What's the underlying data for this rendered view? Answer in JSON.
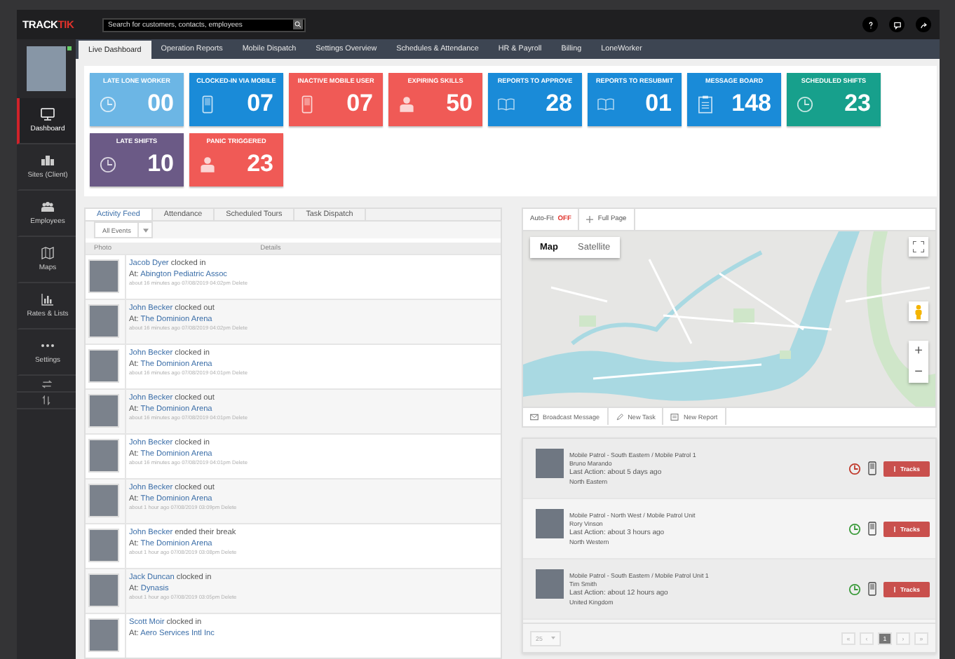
{
  "topbar": {
    "logo": {
      "part_1": "TRACK",
      "part_2": "TIK"
    },
    "search": {
      "placeholder": "Search for customers, contacts, employees"
    }
  },
  "sidebar": {
    "items": [
      {
        "label": "Dashboard",
        "kind": "monitor",
        "selected": true
      },
      {
        "label": "Sites (Client)",
        "kind": "building",
        "selected": false
      },
      {
        "label": "Employees",
        "kind": "people",
        "selected": false
      },
      {
        "label": "Maps",
        "kind": "map",
        "selected": false
      },
      {
        "label": "Rates & Lists",
        "kind": "chart",
        "selected": false
      },
      {
        "label": "Settings",
        "kind": "dots",
        "selected": false
      }
    ]
  },
  "tabs": [
    {
      "label": "Live Dashboard",
      "selected": true
    },
    {
      "label": "Operation Reports",
      "selected": false
    },
    {
      "label": "Mobile Dispatch",
      "selected": false
    },
    {
      "label": "Settings Overview",
      "selected": false
    },
    {
      "label": "Schedules & Attendance",
      "selected": false
    },
    {
      "label": "HR & Payroll",
      "selected": false
    },
    {
      "label": "Billing",
      "selected": false
    },
    {
      "label": "LoneWorker",
      "selected": false
    }
  ],
  "tiles": [
    {
      "label": "LATE LONE WORKER",
      "value": "00",
      "kind": "clock",
      "color": "#6cb6e5"
    },
    {
      "label": "CLOCKED-IN VIA MOBILE",
      "value": "07",
      "kind": "phone",
      "color": "#1a8bd8"
    },
    {
      "label": "INACTIVE MOBILE USER",
      "value": "07",
      "kind": "phone",
      "color": "#f05a56"
    },
    {
      "label": "EXPIRING SKILLS",
      "value": "50",
      "kind": "person",
      "color": "#f05a56"
    },
    {
      "label": "REPORTS TO APPROVE",
      "value": "28",
      "kind": "book",
      "color": "#1a8bd8"
    },
    {
      "label": "REPORTS TO RESUBMIT",
      "value": "01",
      "kind": "book",
      "color": "#1a8bd8"
    },
    {
      "label": "MESSAGE BOARD",
      "value": "148",
      "kind": "clipboard",
      "color": "#1a8bd8"
    },
    {
      "label": "SCHEDULED SHIFTS",
      "value": "23",
      "kind": "clock",
      "color": "#17a08c"
    },
    {
      "label": "LATE SHIFTS",
      "value": "10",
      "kind": "clock",
      "color": "#6b5a86"
    },
    {
      "label": "PANIC TRIGGERED",
      "value": "23",
      "kind": "person",
      "color": "#f05a56"
    }
  ],
  "activity": {
    "tabs": [
      {
        "label": "Activity Feed",
        "selected": true
      },
      {
        "label": "Attendance",
        "selected": false
      },
      {
        "label": "Scheduled Tours",
        "selected": false
      },
      {
        "label": "Task Dispatch",
        "selected": false
      }
    ],
    "filter": "All Events",
    "columns": [
      "Photo",
      "Details"
    ],
    "rows": [
      {
        "name": "Jacob Dyer",
        "action": "clocked in",
        "at_label": "At:",
        "place": "Abington Pediatric Assoc",
        "time": "about 16 minutes ago",
        "stamp": "07/08/2019 04:02pm",
        "delete": "Delete"
      },
      {
        "name": "John Becker",
        "action": "clocked out",
        "at_label": "At:",
        "place": "The Dominion Arena",
        "time": "about 16 minutes ago",
        "stamp": "07/08/2019 04:02pm",
        "delete": "Delete"
      },
      {
        "name": "John Becker",
        "action": "clocked in",
        "at_label": "At:",
        "place": "The Dominion Arena",
        "time": "about 16 minutes ago",
        "stamp": "07/08/2019 04:01pm",
        "delete": "Delete"
      },
      {
        "name": "John Becker",
        "action": "clocked out",
        "at_label": "At:",
        "place": "The Dominion Arena",
        "time": "about 16 minutes ago",
        "stamp": "07/08/2019 04:01pm",
        "delete": "Delete"
      },
      {
        "name": "John Becker",
        "action": "clocked in",
        "at_label": "At:",
        "place": "The Dominion Arena",
        "time": "about 16 minutes ago",
        "stamp": "07/08/2019 04:01pm",
        "delete": "Delete"
      },
      {
        "name": "John Becker",
        "action": "clocked out",
        "at_label": "At:",
        "place": "The Dominion Arena",
        "time": "about 1 hour ago",
        "stamp": "07/08/2019 03:09pm",
        "delete": "Delete"
      },
      {
        "name": "John Becker",
        "action": "ended their break",
        "at_label": "At:",
        "place": "The Dominion Arena",
        "time": "about 1 hour ago",
        "stamp": "07/08/2019 03:08pm",
        "delete": "Delete"
      },
      {
        "name": "Jack Duncan",
        "action": "clocked in",
        "at_label": "At:",
        "place": "Dynasis",
        "time": "about 1 hour ago",
        "stamp": "07/08/2019 03:05pm",
        "delete": "Delete"
      },
      {
        "name": "Scott Moir",
        "action": "clocked in",
        "at_label": "At:",
        "place": "Aero Services Intl Inc"
      }
    ]
  },
  "map": {
    "autofit": {
      "label": "Auto-Fit",
      "state": "OFF"
    },
    "full_page": "Full Page",
    "types": [
      {
        "label": "Map",
        "selected": true
      },
      {
        "label": "Satellite",
        "selected": false
      }
    ],
    "zoom_in": "+",
    "zoom_out": "−",
    "actions": [
      {
        "label": "Broadcast Message",
        "kind": "message"
      },
      {
        "label": "New Task",
        "kind": "task"
      },
      {
        "label": "New Report",
        "kind": "report"
      }
    ]
  },
  "patrols": {
    "rows": [
      {
        "unit": "Mobile Patrol - South Eastern / Mobile Patrol 1",
        "name": "Bruno Marando",
        "last_action": "Last Action: about 5 days ago",
        "region": "North Eastern",
        "color": "#c0392b",
        "button": "Tracks"
      },
      {
        "unit": "Mobile Patrol - North West / Mobile Patrol Unit",
        "name": "Rory Vinson",
        "last_action": "Last Action: about 3 hours ago",
        "region": "North Western",
        "color": "#3a9a3a",
        "button": "Tracks"
      },
      {
        "unit": "Mobile Patrol - South Eastern / Mobile Patrol Unit 1",
        "name": "Tim Smith",
        "last_action": "Last Action: about 12 hours ago",
        "region": "United Kingdom",
        "color": "#3a9a3a",
        "button": "Tracks"
      }
    ],
    "page_size": "25",
    "nav_before": [
      "«",
      "‹"
    ],
    "pages": [
      {
        "label": "1",
        "selected": true
      }
    ],
    "nav_after": [
      "›",
      "»"
    ]
  }
}
